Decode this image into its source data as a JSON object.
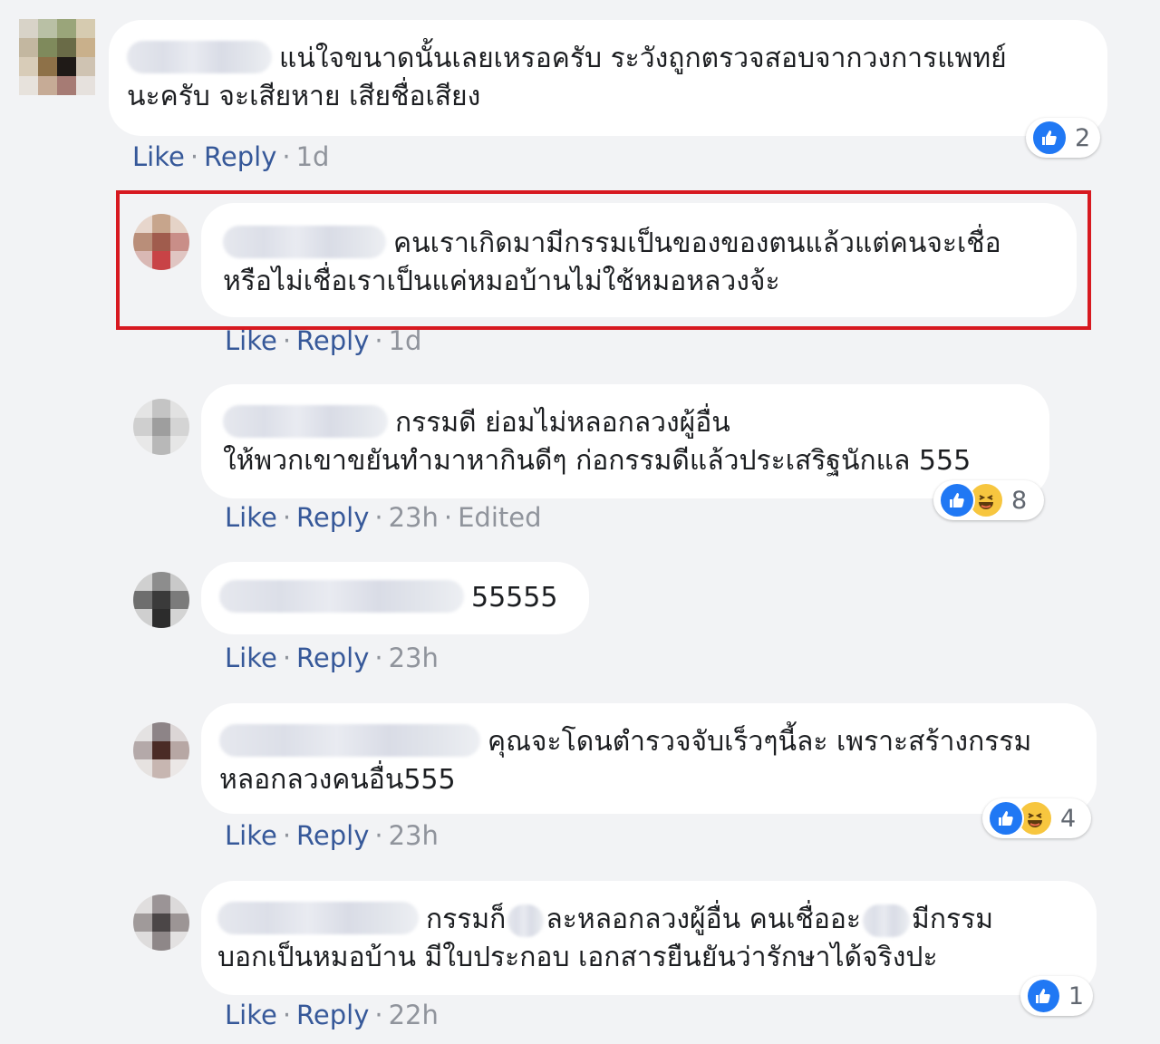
{
  "comments": [
    {
      "text_line1": "แน่ใจขนาดนั้นเลยเหรอครับ ระวังถูกตรวจสอบจากวงการแพทย์",
      "text_line2": "นะครับ จะเสียหาย เสียชื่อเสียง",
      "like": "Like",
      "reply": "Reply",
      "time": "1d",
      "reaction_count": "2"
    },
    {
      "text_line1": "คนเราเกิดมามีกรรมเป็นของของตนแล้วแต่คนจะเชื่อ",
      "text_line2": "หรือไม่เชื่อเราเป็นแค่หมอบ้านไม่ใช้หมอหลวงจ้ะ",
      "like": "Like",
      "reply": "Reply",
      "time": "1d"
    },
    {
      "text_line1": "กรรมดี ย่อมไม่หลอกลวงผู้อื่น",
      "text_line2": "ให้พวกเขาขยันทำมาหากินดีๆ ก่อกรรมดีแล้วประเสริฐนักแล 555",
      "like": "Like",
      "reply": "Reply",
      "time": "23h",
      "edited": "Edited",
      "reaction_count": "8"
    },
    {
      "text_line1": "55555",
      "like": "Like",
      "reply": "Reply",
      "time": "23h"
    },
    {
      "text_line1": "คุณจะโดนตำรวจจับเร็วๆนี้ละ เพราะสร้างกรรม",
      "text_line2": "หลอกลวงคนอื่น555",
      "like": "Like",
      "reply": "Reply",
      "time": "23h",
      "reaction_count": "4"
    },
    {
      "text_line1a": "กรรมก็",
      "text_line1b": "ละหลอกลวงผู้อื่น คนเชื่ออะ",
      "text_line1c": "มีกรรม",
      "text_line2": "บอกเป็นหมอบ้าน มีใบประกอบ เอกสารยืนยันว่ารักษาได้จริงปะ",
      "like": "Like",
      "reply": "Reply",
      "time": "22h",
      "reaction_count": "1"
    }
  ],
  "colors": {
    "link": "#365899",
    "meta": "#90949c",
    "like_blue": "#2078f4",
    "haha_yellow": "#f7c63f",
    "highlight": "#d71920"
  },
  "icons": {
    "like": "thumbs-up-icon",
    "haha": "laughing-face-icon"
  }
}
